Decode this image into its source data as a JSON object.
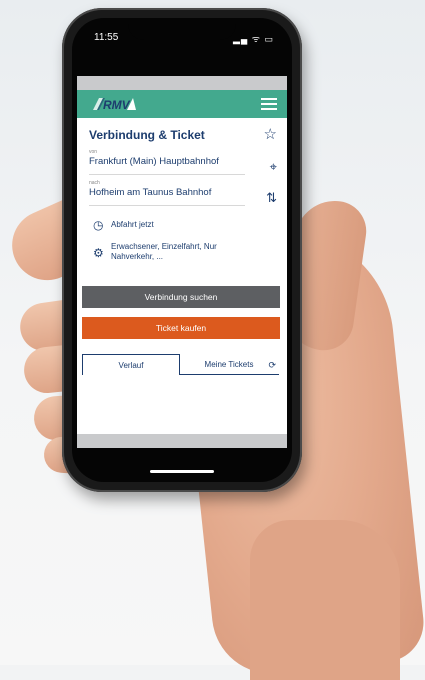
{
  "status_bar": {
    "time": "11:55",
    "icons": "▂▄ ᯤ ▭"
  },
  "header": {
    "logo_alt": "RMV",
    "menu_icon": "hamburger-menu-icon"
  },
  "page": {
    "title": "Verbindung & Ticket",
    "favorite_icon": "star-icon"
  },
  "from": {
    "label": "von",
    "value": "Frankfurt (Main) Hauptbahnhof",
    "icon": "location-crosshair-icon"
  },
  "to": {
    "label": "nach",
    "value": "Hofheim am Taunus Bahnhof",
    "icon": "swap-arrows-icon"
  },
  "options": {
    "departure": "Abfahrt jetzt",
    "passenger_line1": "Erwachsener, Einzelfahrt, Nur",
    "passenger_line2": "Nahverkehr, ..."
  },
  "buttons": {
    "search": "Verbindung suchen",
    "buy": "Ticket kaufen"
  },
  "tabs": [
    {
      "label": "Verlauf"
    },
    {
      "label": "Meine Tickets"
    }
  ],
  "colors": {
    "header": "#43a98e",
    "text": "#1d3d6e",
    "search_btn": "#5d5f62",
    "buy_btn": "#dc5a1e"
  }
}
